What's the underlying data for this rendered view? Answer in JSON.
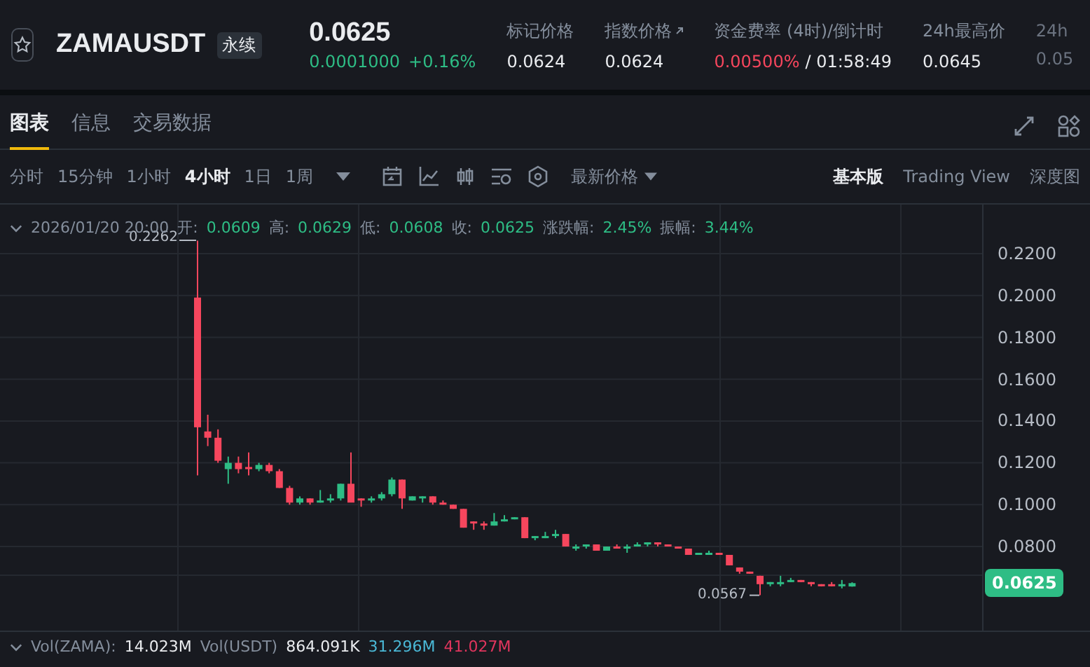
{
  "header": {
    "symbol": "ZAMAUSDT",
    "contract_badge": "永续",
    "price": "0.0625",
    "change": "0.0001000",
    "change_percent": "+0.16%",
    "stats": [
      {
        "label": "标记价格",
        "value": "0.0624",
        "kind": "plain"
      },
      {
        "label": "指数价格",
        "value": "0.0624",
        "kind": "link"
      },
      {
        "label": "资金费率 (4时)/倒计时",
        "value": "0.00500%",
        "countdown": "/ 01:58:49",
        "kind": "funding"
      },
      {
        "label": "24h最高价",
        "value": "0.0645",
        "kind": "plain"
      },
      {
        "label": "24h",
        "value": "0.05",
        "kind": "faded"
      }
    ]
  },
  "tabs": [
    {
      "label": "图表",
      "selected": true
    },
    {
      "label": "信息",
      "selected": false
    },
    {
      "label": "交易数据",
      "selected": false
    }
  ],
  "intervals": [
    {
      "label": "分时",
      "selected": false
    },
    {
      "label": "15分钟",
      "selected": false
    },
    {
      "label": "1小时",
      "selected": false
    },
    {
      "label": "4小时",
      "selected": true
    },
    {
      "label": "1日",
      "selected": false
    },
    {
      "label": "1周",
      "selected": false
    }
  ],
  "price_type": "最新价格",
  "views": [
    {
      "label": "基本版",
      "selected": true
    },
    {
      "label": "Trading View",
      "selected": false
    },
    {
      "label": "深度图",
      "selected": false
    }
  ],
  "legend": {
    "time": "2026/01/20 20:00",
    "items": [
      {
        "label": "开:",
        "value": "0.0609"
      },
      {
        "label": "高:",
        "value": "0.0629"
      },
      {
        "label": "低:",
        "value": "0.0608"
      },
      {
        "label": "收:",
        "value": "0.0625"
      },
      {
        "label": "涨跌幅:",
        "value": "2.45%"
      },
      {
        "label": "振幅:",
        "value": "3.44%"
      }
    ]
  },
  "chart": {
    "y_ticks": [
      "0.2200",
      "0.2000",
      "0.1800",
      "0.1600",
      "0.1400",
      "0.1200",
      "0.1000",
      "0.0800"
    ],
    "high_mark": "0.2262",
    "low_mark": "0.0567",
    "last_price": "0.0625"
  },
  "volume": {
    "label": "Vol(ZAMA):",
    "value": "14.023M",
    "label2": "Vol(USDT)",
    "value2": "864.091K",
    "ma1": "31.296M",
    "ma2": "41.027M"
  }
}
